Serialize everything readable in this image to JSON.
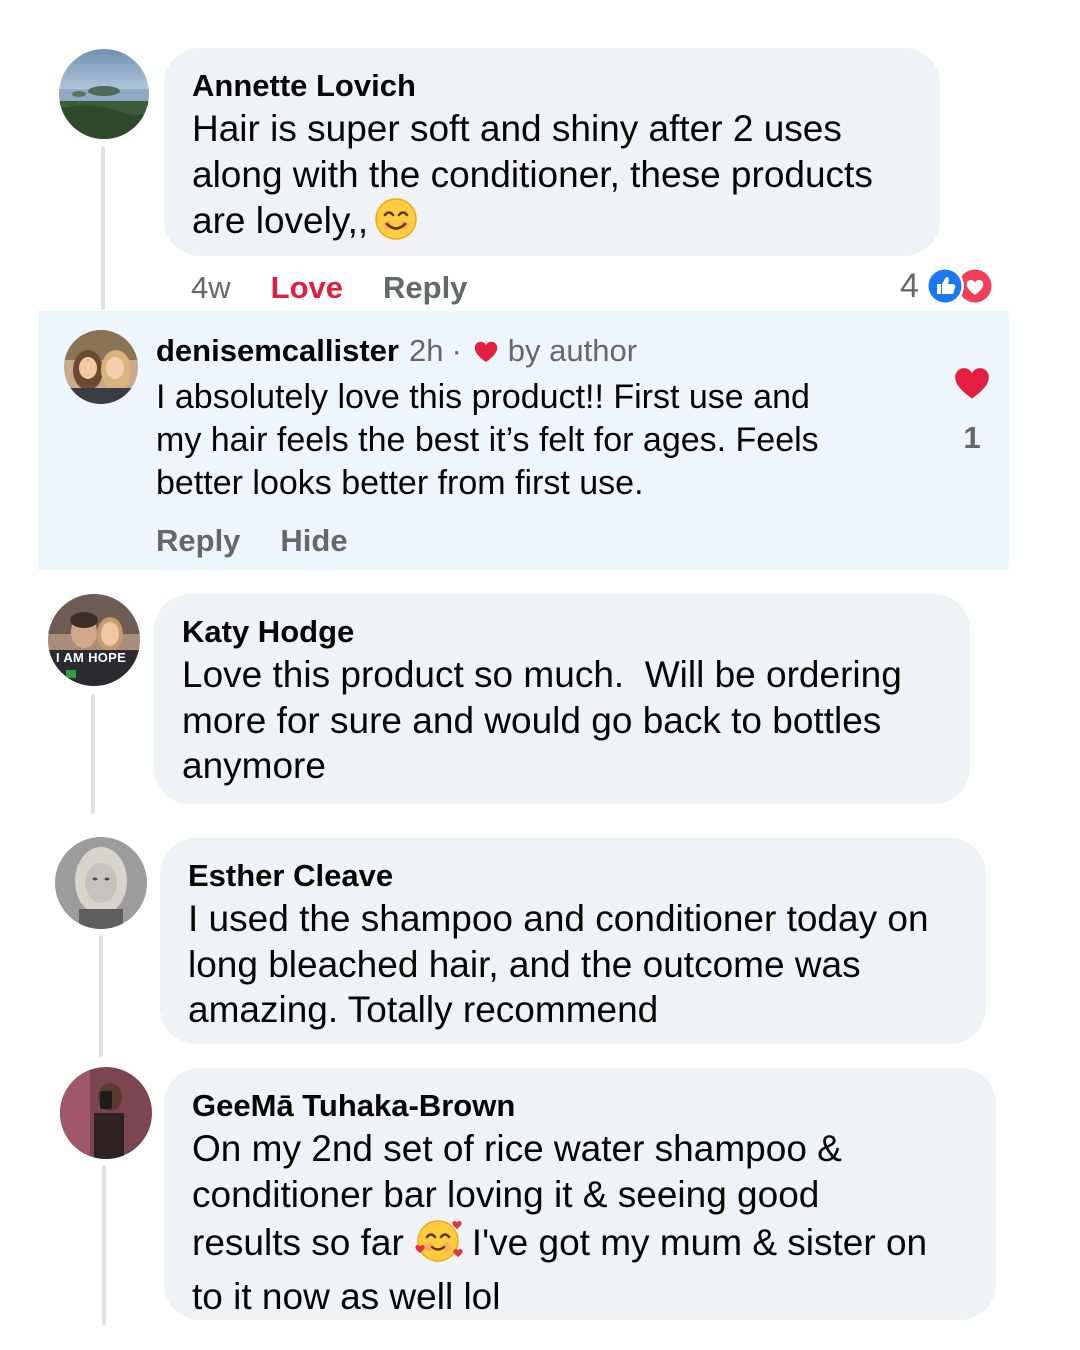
{
  "comments": [
    {
      "author": "Annette Lovich",
      "lines": [
        "Hair is super soft and shiny after 2 uses",
        "along with the conditioner, these products",
        "are lovely,,"
      ],
      "emoji": "smiling-face-icon",
      "time": "4w",
      "reacted": "Love",
      "reply_label": "Reply",
      "reaction_count": "4",
      "reaction_icons": [
        "like-icon",
        "love-icon"
      ]
    },
    {
      "author": "Katy Hodge",
      "lines": [
        "Love this product so much.  Will be ordering",
        "more for sure and would go back to bottles",
        "anymore"
      ],
      "avatar_text": "I AM HOPE"
    },
    {
      "author": "Esther Cleave",
      "lines": [
        "I used the shampoo and conditioner today on",
        "long bleached hair, and the outcome was",
        "amazing. Totally recommend"
      ]
    },
    {
      "author": "GeeMā Tuhaka-Brown",
      "lines": [
        "On my 2nd set of rice water shampoo &",
        "conditioner bar loving it & seeing good",
        "results so far",
        "I've got my mum & sister on",
        "to it now as well lol"
      ],
      "emoji": "smiling-face-with-hearts-icon"
    }
  ],
  "author_reply": {
    "author": "denisemcallister",
    "time": "2h",
    "separator": "·",
    "badge": "by author",
    "lines": [
      "I absolutely love this product!! First use and",
      "my hair feels the best it’s felt for ages. Feels",
      "better looks better from first use."
    ],
    "like_count": "1",
    "reply_label": "Reply",
    "hide_label": "Hide"
  },
  "colors": {
    "bubble": "#f0f2f5",
    "highlight": "#eef6fd",
    "love_red": "#e41e3f",
    "like_blue": "#1877f2",
    "meta_gray": "#65676b"
  }
}
